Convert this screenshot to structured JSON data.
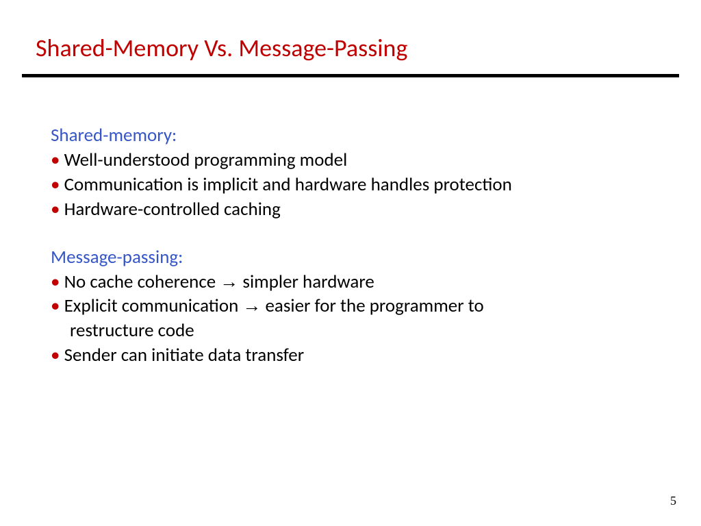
{
  "title": "Shared-Memory Vs. Message-Passing",
  "section1": {
    "heading": "Shared-memory:",
    "items": [
      "Well-understood programming model",
      "Communication is implicit and hardware handles protection",
      "Hardware-controlled caching"
    ]
  },
  "section2": {
    "heading": "Message-passing:",
    "items": [
      {
        "pre": "No cache coherence ",
        "arrow": "→",
        "post": " simpler hardware"
      },
      {
        "pre": "Explicit communication ",
        "arrow": "→",
        "post": " easier for the programmer to",
        "cont": "restructure code"
      },
      {
        "pre": "Sender can initiate data transfer"
      }
    ]
  },
  "bullet": "• ",
  "page_number": "5"
}
